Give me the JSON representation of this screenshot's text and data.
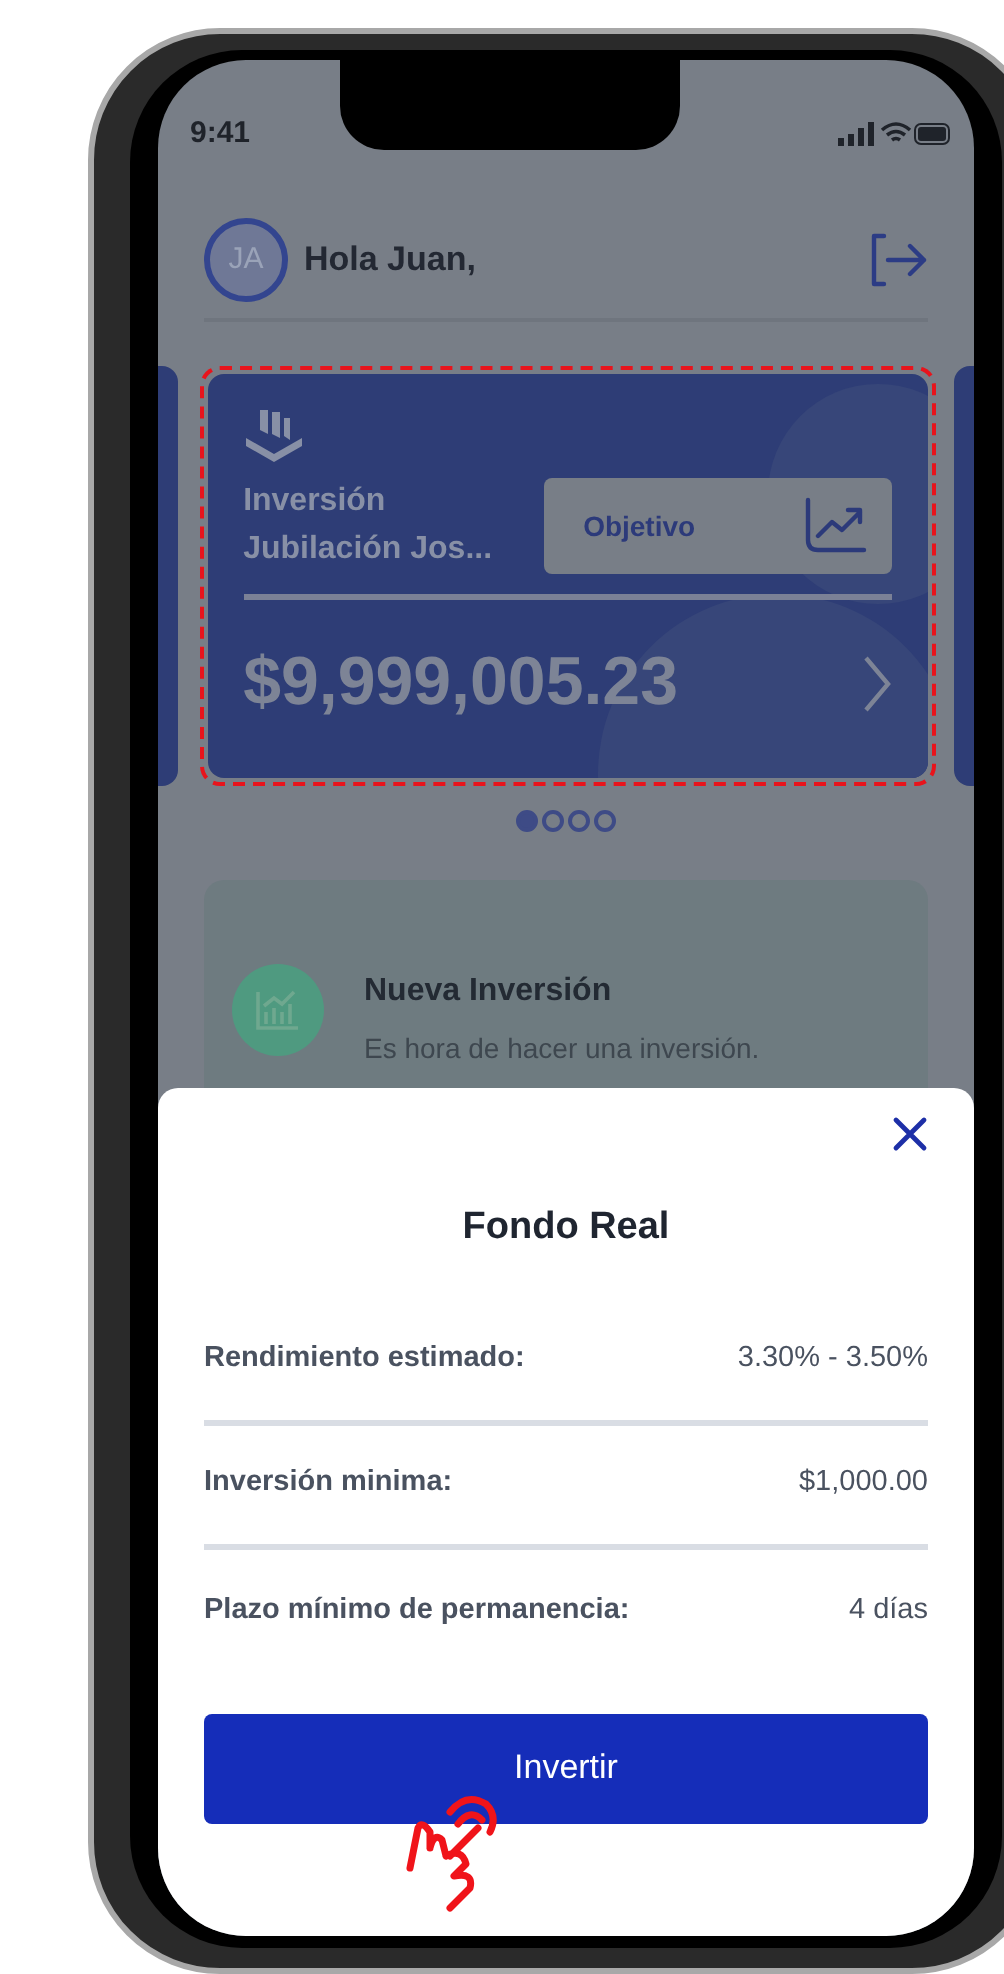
{
  "status_bar": {
    "time": "9:41"
  },
  "header": {
    "avatar_initials": "JA",
    "greeting": "Hola Juan,"
  },
  "carousel": {
    "card": {
      "title": "Inversión Jubilación Jos...",
      "objective_button": "Objetivo",
      "amount": "$9,999,005.23",
      "highlighted": true
    },
    "dots": [
      {
        "selected": true
      },
      {
        "selected": false
      },
      {
        "selected": false
      },
      {
        "selected": false
      }
    ]
  },
  "notification": {
    "title": "Nueva Inversión",
    "message": "Es hora de hacer una inversión."
  },
  "sheet": {
    "title": "Fondo Real",
    "rows": [
      {
        "label": "Rendimiento estimado:",
        "value": "3.30% - 3.50%"
      },
      {
        "label": "Inversión minima:",
        "value": "$1,000.00"
      },
      {
        "label": "Plazo mínimo de permanencia:",
        "value": "4 días"
      }
    ],
    "button": "Invertir"
  }
}
